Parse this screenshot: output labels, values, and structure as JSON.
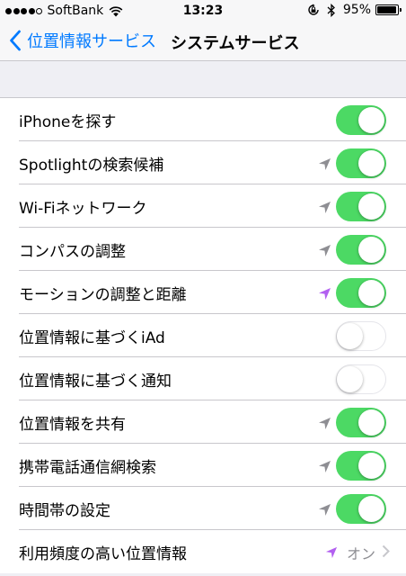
{
  "status": {
    "carrier": "SoftBank",
    "time": "13:23",
    "battery": "95%",
    "battery_level": 0.95
  },
  "nav": {
    "back_label": "位置情報サービス",
    "title": "システムサービス"
  },
  "colors": {
    "accent": "#007aff",
    "toggle_on": "#4cd964",
    "arrow_gray": "#8e8e93",
    "arrow_purple": "#b260f0"
  },
  "rows": [
    {
      "label": "iPhoneを探す",
      "toggle": "on",
      "arrow": "none"
    },
    {
      "label": "Spotlightの検索候補",
      "toggle": "on",
      "arrow": "gray"
    },
    {
      "label": "Wi-Fiネットワーク",
      "toggle": "on",
      "arrow": "gray"
    },
    {
      "label": "コンパスの調整",
      "toggle": "on",
      "arrow": "gray"
    },
    {
      "label": "モーションの調整と距離",
      "toggle": "on",
      "arrow": "purple"
    },
    {
      "label": "位置情報に基づくiAd",
      "toggle": "off",
      "arrow": "none"
    },
    {
      "label": "位置情報に基づく通知",
      "toggle": "off",
      "arrow": "none"
    },
    {
      "label": "位置情報を共有",
      "toggle": "on",
      "arrow": "gray"
    },
    {
      "label": "携帯電話通信網検索",
      "toggle": "on",
      "arrow": "gray"
    },
    {
      "label": "時間帯の設定",
      "toggle": "on",
      "arrow": "gray"
    },
    {
      "label": "利用頻度の高い位置情報",
      "detail": "オン",
      "arrow": "purple"
    }
  ]
}
